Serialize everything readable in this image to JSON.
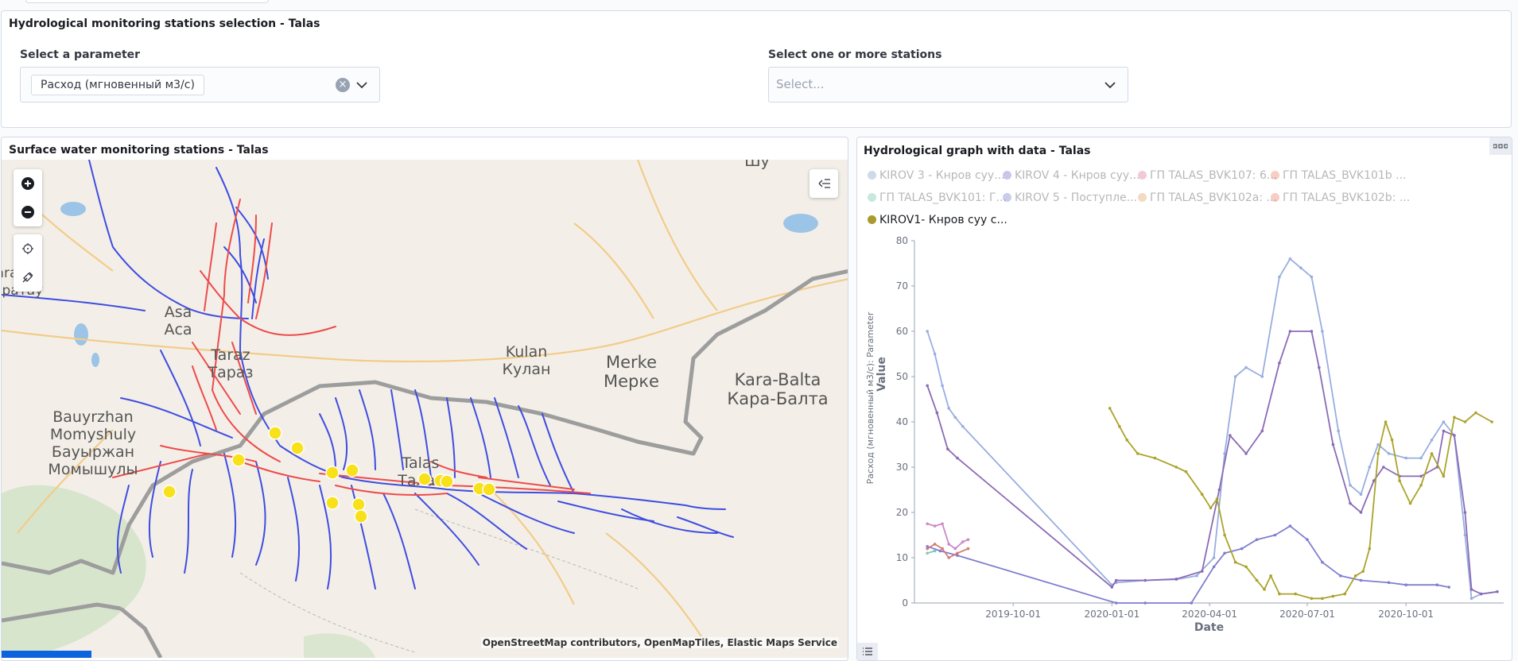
{
  "selection_panel": {
    "title": "Hydrological monitoring stations selection - Talas",
    "parameter_label": "Select a parameter",
    "parameter_value": "Расход (мгновенный м3/с)",
    "stations_label": "Select one or more stations",
    "stations_placeholder": "Select..."
  },
  "map_panel": {
    "title": "Surface water monitoring stations - Talas",
    "attribution": "OpenStreetMap contributors, OpenMapTiles, Elastic Maps Service",
    "place_labels": [
      "Шу",
      "Karatau",
      "Каратау",
      "Asa",
      "Аса",
      "Taraz",
      "Тараз",
      "Kulan",
      "Кулан",
      "Merke",
      "Мерке",
      "Kara-Balta",
      "Кара-Балта",
      "Bauyrzhan",
      "Momyshuly",
      "Бауыржан",
      "Момышулы",
      "Talas",
      "Талас"
    ],
    "station_count": 16,
    "icons": {
      "zoom_in": "plus-circle-icon",
      "zoom_out": "minus-circle-icon",
      "locate": "crosshair-icon",
      "draw": "draw-tool-icon",
      "layers": "collapse-layers-icon"
    }
  },
  "graph_panel": {
    "title": "Hydrological graph with data - Talas",
    "options_icon": "panel-options-icon",
    "legend_icon": "list-icon",
    "legend": [
      {
        "label": "KIROV 3 - Кнров суу...",
        "color": "#6092c0",
        "active": false
      },
      {
        "label": "KIROV 4 - Кнров суу...",
        "color": "#5a4fbf",
        "active": false
      },
      {
        "label": "ГП TALAS_BVK107: 6...",
        "color": "#d36086",
        "active": false
      },
      {
        "label": "ГП TALAS_BVK101b ...",
        "color": "#e7664c",
        "active": false
      },
      {
        "label": "ГП TALAS_BVK101: Г...",
        "color": "#54b399",
        "active": false
      },
      {
        "label": "KIROV 5 - Поступле...",
        "color": "#5a5fc0",
        "active": false
      },
      {
        "label": "ГП TALAS_BVK102a: ...",
        "color": "#da8b45",
        "active": false
      },
      {
        "label": "ГП TALAS_BVK102b: ...",
        "color": "#e7664c",
        "active": false
      },
      {
        "label": "KIROV1- Кнров суу с...",
        "color": "#aa9a2d",
        "active": true
      }
    ]
  },
  "chart_data": {
    "type": "line",
    "xlabel": "Date",
    "ylabel": "Value",
    "ylabel_sub": "Расход (мгновенный м3/с): Parameter",
    "ylim": [
      0,
      80
    ],
    "yticks": [
      0,
      10,
      20,
      30,
      40,
      50,
      60,
      70,
      80
    ],
    "xticks": [
      "2019-10-01",
      "2020-01-01",
      "2020-04-01",
      "2020-07-01",
      "2020-10-01"
    ],
    "xlim": [
      "2019-07-01",
      "2020-12-31"
    ],
    "series": [
      {
        "name": "KIROV 3 - Кнров суу...",
        "color": "#98aee0",
        "points": [
          [
            "2019-07-13",
            60
          ],
          [
            "2019-07-20",
            55
          ],
          [
            "2019-07-27",
            48
          ],
          [
            "2019-08-02",
            43
          ],
          [
            "2019-08-08",
            41
          ],
          [
            "2019-08-15",
            39
          ],
          [
            "2020-01-01",
            4
          ],
          [
            "2020-01-05",
            4.5
          ],
          [
            "2020-02-01",
            5
          ],
          [
            "2020-03-01",
            5.2
          ],
          [
            "2020-03-20",
            6
          ],
          [
            "2020-04-05",
            10
          ],
          [
            "2020-04-15",
            33
          ],
          [
            "2020-04-25",
            50
          ],
          [
            "2020-05-05",
            52
          ],
          [
            "2020-05-20",
            50
          ],
          [
            "2020-06-05",
            72
          ],
          [
            "2020-06-15",
            76
          ],
          [
            "2020-06-25",
            74
          ],
          [
            "2020-07-05",
            72
          ],
          [
            "2020-07-15",
            60
          ],
          [
            "2020-07-30",
            38
          ],
          [
            "2020-08-10",
            26
          ],
          [
            "2020-08-20",
            24
          ],
          [
            "2020-08-28",
            30
          ],
          [
            "2020-09-05",
            35
          ],
          [
            "2020-09-15",
            33
          ],
          [
            "2020-10-01",
            32
          ],
          [
            "2020-10-15",
            32
          ],
          [
            "2020-10-25",
            36
          ],
          [
            "2020-11-05",
            40
          ],
          [
            "2020-11-15",
            37
          ],
          [
            "2020-11-25",
            15
          ],
          [
            "2020-12-01",
            1
          ],
          [
            "2020-12-10",
            2
          ],
          [
            "2020-12-25",
            2.5
          ]
        ]
      },
      {
        "name": "KIROV 4 - Кнров суу...",
        "color": "#8b6bb5",
        "points": [
          [
            "2019-07-13",
            48
          ],
          [
            "2019-07-22",
            42
          ],
          [
            "2019-08-01",
            34
          ],
          [
            "2019-08-10",
            32
          ],
          [
            "2020-01-01",
            3.5
          ],
          [
            "2020-01-05",
            5
          ],
          [
            "2020-02-01",
            5
          ],
          [
            "2020-03-01",
            5.3
          ],
          [
            "2020-03-25",
            7
          ],
          [
            "2020-04-10",
            25
          ],
          [
            "2020-04-20",
            37
          ],
          [
            "2020-05-05",
            33
          ],
          [
            "2020-05-20",
            38
          ],
          [
            "2020-06-05",
            53
          ],
          [
            "2020-06-15",
            60
          ],
          [
            "2020-07-05",
            60
          ],
          [
            "2020-07-12",
            52
          ],
          [
            "2020-07-25",
            35
          ],
          [
            "2020-08-10",
            22
          ],
          [
            "2020-08-20",
            20
          ],
          [
            "2020-09-01",
            27
          ],
          [
            "2020-09-10",
            30
          ],
          [
            "2020-09-25",
            28
          ],
          [
            "2020-10-15",
            28
          ],
          [
            "2020-10-30",
            30
          ],
          [
            "2020-11-05",
            38
          ],
          [
            "2020-11-15",
            37
          ],
          [
            "2020-11-25",
            20
          ],
          [
            "2020-12-01",
            3
          ],
          [
            "2020-12-10",
            2
          ],
          [
            "2020-12-25",
            2.5
          ]
        ]
      },
      {
        "name": "KIROV 5 - Поступле...",
        "color": "#7f7fd0",
        "points": [
          [
            "2019-07-13",
            12.5
          ],
          [
            "2019-07-25",
            11.5
          ],
          [
            "2019-08-10",
            10.5
          ],
          [
            "2020-01-05",
            0
          ],
          [
            "2020-02-01",
            0
          ],
          [
            "2020-03-15",
            0
          ],
          [
            "2020-04-05",
            8
          ],
          [
            "2020-04-15",
            11
          ],
          [
            "2020-05-01",
            12
          ],
          [
            "2020-05-15",
            14
          ],
          [
            "2020-06-01",
            15
          ],
          [
            "2020-06-15",
            17
          ],
          [
            "2020-07-01",
            14
          ],
          [
            "2020-07-15",
            9
          ],
          [
            "2020-08-01",
            6
          ],
          [
            "2020-08-20",
            5
          ],
          [
            "2020-09-15",
            4.5
          ],
          [
            "2020-10-01",
            4
          ],
          [
            "2020-10-30",
            4
          ],
          [
            "2020-11-10",
            3.5
          ]
        ]
      },
      {
        "name": "ГП TALAS_BVK107: 6...",
        "color": "#cc88c8",
        "points": [
          [
            "2019-07-13",
            17.5
          ],
          [
            "2019-07-20",
            17
          ],
          [
            "2019-07-27",
            17.5
          ],
          [
            "2019-08-02",
            13
          ],
          [
            "2019-08-08",
            12
          ],
          [
            "2019-08-15",
            13.5
          ],
          [
            "2019-08-20",
            14
          ]
        ]
      },
      {
        "name": "ГП TALAS_BVK101b ...",
        "color": "#d47a76",
        "points": [
          [
            "2019-07-13",
            12
          ],
          [
            "2019-07-20",
            13
          ],
          [
            "2019-07-27",
            12
          ],
          [
            "2019-08-02",
            10
          ],
          [
            "2019-08-10",
            11
          ],
          [
            "2019-08-20",
            12
          ]
        ]
      },
      {
        "name": "ГП TALAS_BVK101: Г...",
        "color": "#7cc8b8",
        "points": [
          [
            "2019-07-13",
            11
          ],
          [
            "2019-07-20",
            11.5
          ]
        ]
      },
      {
        "name": "KIROV1- Кнров суу с...",
        "color": "#aba32c",
        "points": [
          [
            "2019-12-30",
            43
          ],
          [
            "2020-01-08",
            39
          ],
          [
            "2020-01-15",
            36
          ],
          [
            "2020-01-25",
            33
          ],
          [
            "2020-02-10",
            32
          ],
          [
            "2020-03-01",
            30
          ],
          [
            "2020-03-10",
            29
          ],
          [
            "2020-03-25",
            24
          ],
          [
            "2020-04-02",
            21
          ],
          [
            "2020-04-08",
            23
          ],
          [
            "2020-04-15",
            15
          ],
          [
            "2020-04-25",
            9
          ],
          [
            "2020-05-05",
            8
          ],
          [
            "2020-05-15",
            5
          ],
          [
            "2020-05-22",
            3
          ],
          [
            "2020-05-28",
            6
          ],
          [
            "2020-06-05",
            2
          ],
          [
            "2020-06-20",
            2
          ],
          [
            "2020-07-05",
            1
          ],
          [
            "2020-07-15",
            1
          ],
          [
            "2020-07-25",
            1.5
          ],
          [
            "2020-08-05",
            2
          ],
          [
            "2020-08-15",
            6
          ],
          [
            "2020-08-22",
            7
          ],
          [
            "2020-08-28",
            12
          ],
          [
            "2020-09-05",
            33
          ],
          [
            "2020-09-12",
            40
          ],
          [
            "2020-09-18",
            36
          ],
          [
            "2020-09-25",
            27
          ],
          [
            "2020-10-05",
            22
          ],
          [
            "2020-10-15",
            26
          ],
          [
            "2020-10-25",
            33
          ],
          [
            "2020-11-05",
            28
          ],
          [
            "2020-11-15",
            41
          ],
          [
            "2020-11-25",
            40
          ],
          [
            "2020-12-05",
            42
          ],
          [
            "2020-12-20",
            40
          ]
        ]
      }
    ]
  }
}
